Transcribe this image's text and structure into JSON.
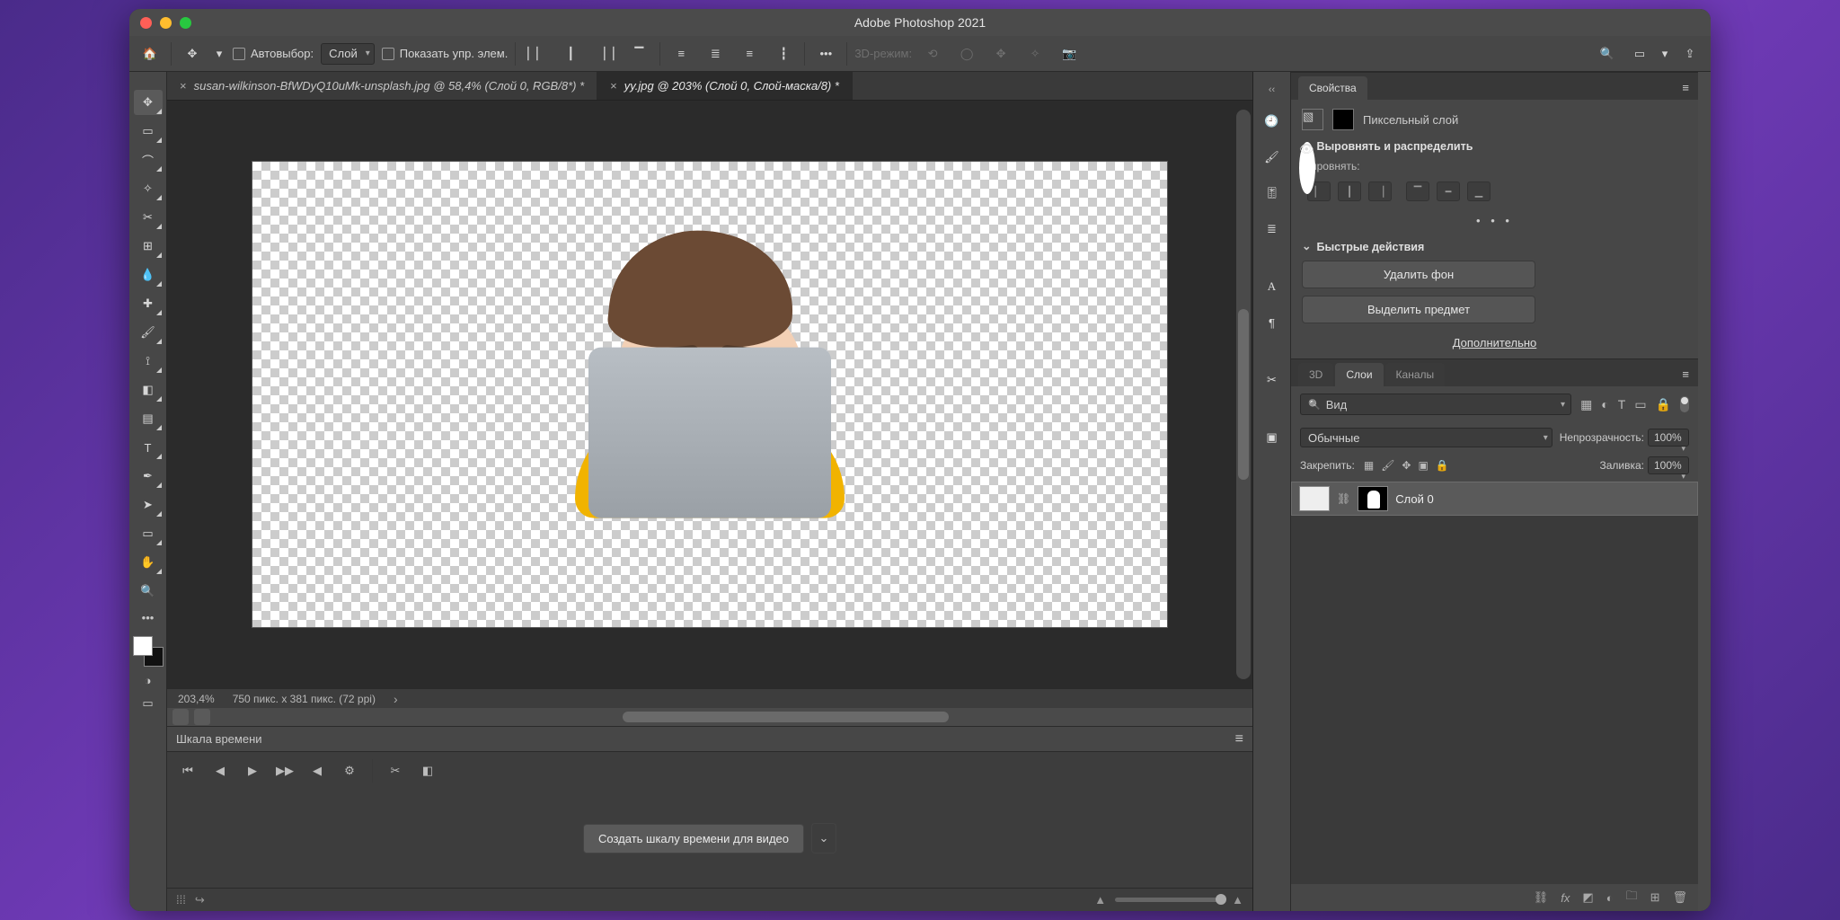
{
  "app_title": "Adobe Photoshop 2021",
  "options": {
    "autoselect": "Автовыбор:",
    "autoselect_target": "Слой",
    "show_transform": "Показать упр. элем.",
    "mode3d": "3D-режим:"
  },
  "tabs": [
    {
      "label": "susan-wilkinson-BfWDyQ10uMk-unsplash.jpg @ 58,4% (Слой 0, RGB/8*) *",
      "active": false
    },
    {
      "label": "yy.jpg @ 203% (Слой 0, Слой-маска/8) *",
      "active": true
    }
  ],
  "status": {
    "zoom": "203,4%",
    "dims": "750 пикс. x 381 пикс. (72 ppi)"
  },
  "timeline": {
    "title": "Шкала времени",
    "cta": "Создать шкалу времени для видео"
  },
  "properties": {
    "panel_title": "Свойства",
    "layer_kind": "Пиксельный слой",
    "section_align": "Выровнять и распределить",
    "align_label": "Выровнять:",
    "section_quick": "Быстрые действия",
    "remove_bg": "Удалить фон",
    "select_subject": "Выделить предмет",
    "more": "Дополнительно"
  },
  "layers": {
    "tab_3d": "3D",
    "tab_layers": "Слои",
    "tab_channels": "Каналы",
    "search_kind": "Вид",
    "blend_mode": "Обычные",
    "opacity_label": "Непрозрачность:",
    "opacity_val": "100%",
    "lock_label": "Закрепить:",
    "fill_label": "Заливка:",
    "fill_val": "100%",
    "layer0": "Слой 0"
  }
}
